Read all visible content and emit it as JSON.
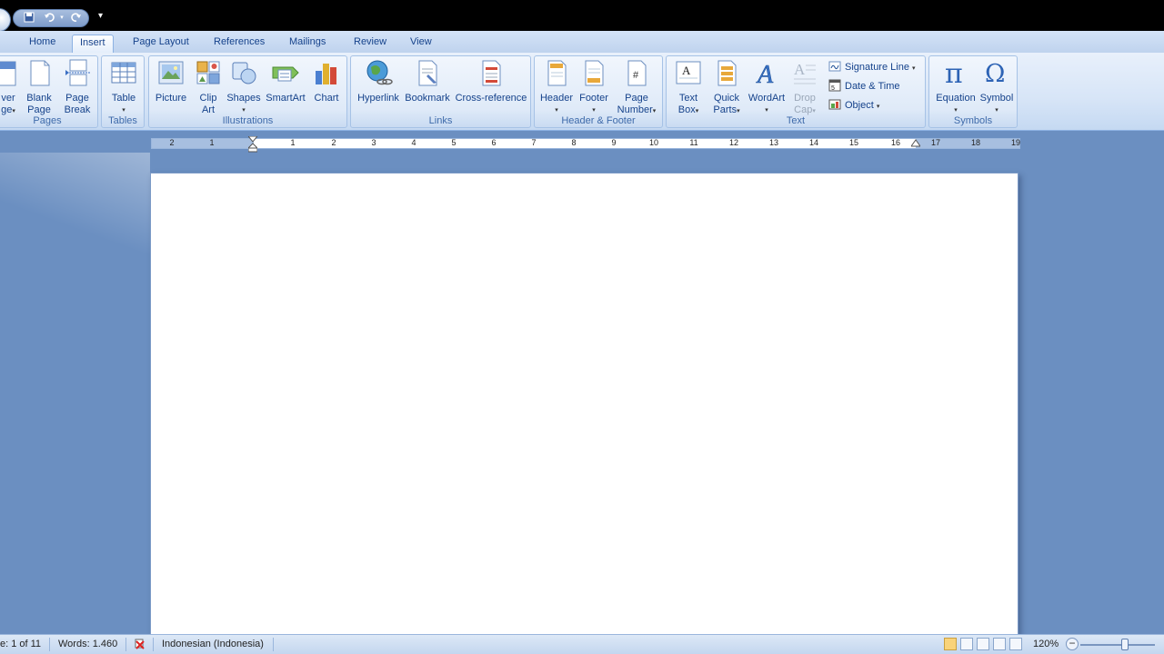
{
  "qat": {
    "save_icon": "save-icon",
    "undo_icon": "undo-icon",
    "redo_icon": "redo-icon",
    "more": "▾"
  },
  "tabs": [
    {
      "label": "Home"
    },
    {
      "label": "Insert"
    },
    {
      "label": "Page Layout"
    },
    {
      "label": "References"
    },
    {
      "label": "Mailings"
    },
    {
      "label": "Review"
    },
    {
      "label": "View"
    }
  ],
  "ribbon": {
    "pages": {
      "label": "Pages",
      "cover_line1": "ver",
      "cover_line2": "ge",
      "blank_line1": "Blank",
      "blank_line2": "Page",
      "break_line1": "Page",
      "break_line2": "Break"
    },
    "tables": {
      "label": "Tables",
      "table": "Table"
    },
    "illustrations": {
      "label": "Illustrations",
      "picture": "Picture",
      "clip_line1": "Clip",
      "clip_line2": "Art",
      "shapes": "Shapes",
      "smartart": "SmartArt",
      "chart": "Chart"
    },
    "links": {
      "label": "Links",
      "hyperlink": "Hyperlink",
      "bookmark": "Bookmark",
      "crossref": "Cross-reference"
    },
    "header_footer": {
      "label": "Header & Footer",
      "header": "Header",
      "footer": "Footer",
      "pagenum_line1": "Page",
      "pagenum_line2": "Number"
    },
    "text": {
      "label": "Text",
      "textbox_line1": "Text",
      "textbox_line2": "Box",
      "quick_line1": "Quick",
      "quick_line2": "Parts",
      "wordart": "WordArt",
      "drop_line1": "Drop",
      "drop_line2": "Cap",
      "signature": "Signature Line",
      "datetime": "Date & Time",
      "object": "Object"
    },
    "symbols": {
      "label": "Symbols",
      "equation": "Equation",
      "symbol": "Symbol"
    }
  },
  "ruler": {
    "left_numbers": [
      "2",
      "1",
      "1"
    ],
    "right_numbers": [
      "1",
      "2",
      "3",
      "4",
      "5",
      "6",
      "7",
      "8",
      "9",
      "10",
      "11",
      "12",
      "13",
      "14",
      "15",
      "16",
      "17",
      "18",
      "19"
    ]
  },
  "status": {
    "page": "e: 1 of 11",
    "words": "Words: 1.460",
    "language": "Indonesian (Indonesia)",
    "zoom": "120%"
  },
  "zoom_level_percent": 120
}
